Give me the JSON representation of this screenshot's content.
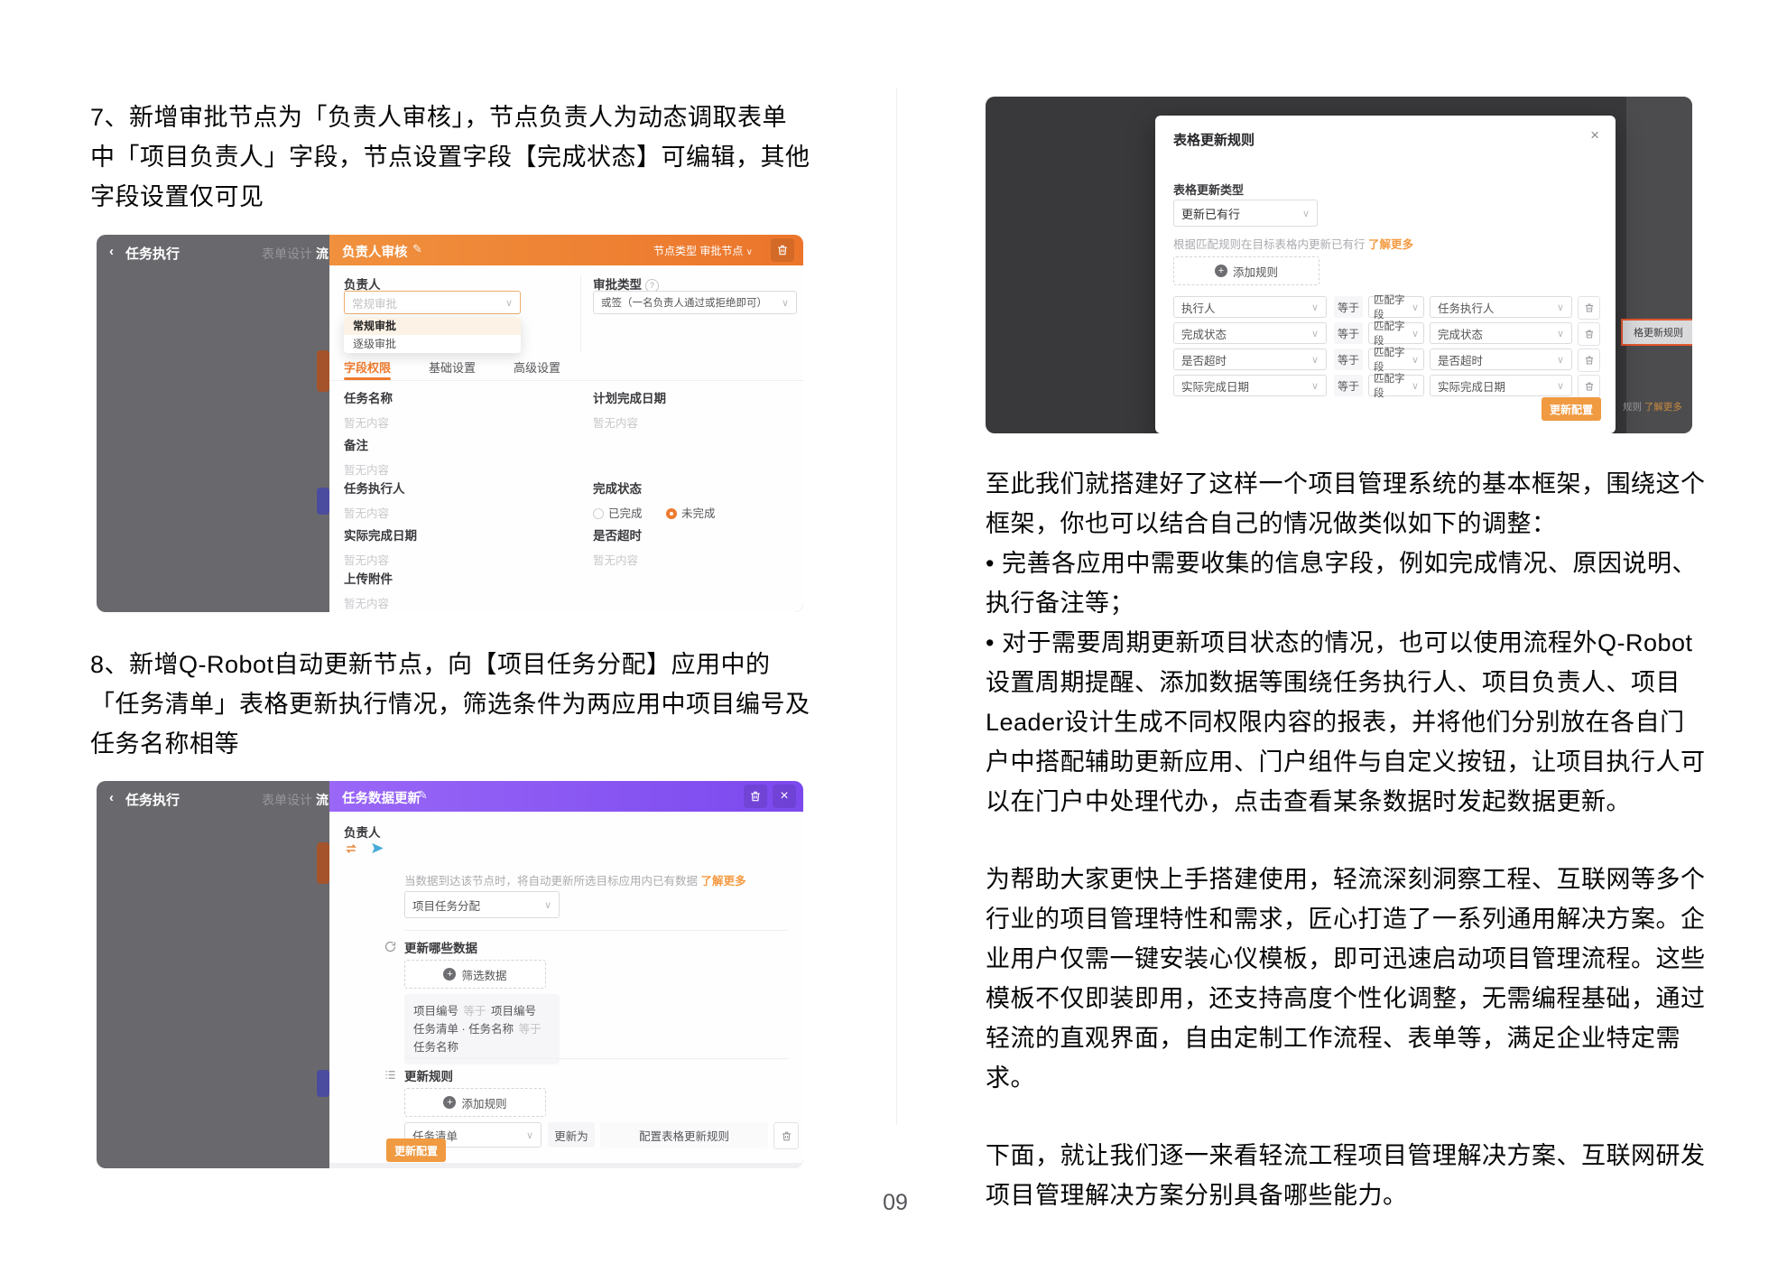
{
  "page": {
    "number": "09"
  },
  "icons": {
    "back": "‹",
    "chevron": "∨",
    "close": "×",
    "info": "?",
    "edit": "✎",
    "plus": "+"
  },
  "steps": {
    "step7": "7、新增审批节点为「负责人审核」，节点负责人为动态调取表单\n中「项目负责人」字段，节点设置字段【完成状态】可编辑，其他\n字段设置仅可见",
    "step8": "8、新增Q-Robot自动更新节点，向【项目任务分配】应用中的\n「任务清单」表格更新执行情况，筛选条件为两应用中项目编号及\n任务名称相等"
  },
  "paragraphs": {
    "p1": "至此我们就搭建好了这样一个项目管理系统的基本框架，围绕这个\n框架，你也可以结合自己的情况做类似如下的调整：\n• 完善各应用中需要收集的信息字段，例如完成情况、原因说明、\n执行备注等；\n• 对于需要周期更新项目状态的情况，也可以使用流程外Q-Robot\n设置周期提醒、添加数据等围绕任务执行人、项目负责人、项目\nLeader设计生成不同权限内容的报表，并将他们分别放在各自门\n户中搭配辅助更新应用、门户组件与自定义按钮，让项目执行人可\n以在门户中处理代办，点击查看某条数据时发起数据更新。",
    "p2": "为帮助大家更快上手搭建使用，轻流深刻洞察工程、互联网等多个\n行业的项目管理特性和需求，匠心打造了一系列通用解决方案。企\n业用户仅需一键安装心仪模板，即可迅速启动项目管理流程。这些\n模板不仅即装即用，还支持高度个性化调整，无需编程基础，通过\n轻流的直观界面，自由定制工作流程、表单等，满足企业特定需\n求。",
    "p3": "下面，就让我们逐一来看轻流工程项目管理解决方案、互联网研发\n项目管理解决方案分别具备哪些能力。"
  },
  "nav": {
    "app_title": "任务执行",
    "tab_form": "表单设计",
    "tab_partial": "流"
  },
  "approval": {
    "title": "负责人审核",
    "node_type_label": "节点类型",
    "node_type_value": "审批节点",
    "owner_label": "负责人",
    "owner_placeholder": "常规审批",
    "options": {
      "opt1": "常规审批",
      "opt2": "逐级审批"
    },
    "approval_type_label": "审批类型",
    "approval_type_value": "或签（一名负责人通过或拒绝即可）",
    "tabs": {
      "t1": "字段权限",
      "t2": "基础设置",
      "t3": "高级设置"
    },
    "empty": "暂无内容",
    "fields": {
      "task_name": "任务名称",
      "plan_date": "计划完成日期",
      "remark": "备注",
      "executor": "任务执行人",
      "status": "完成状态",
      "actual_date": "实际完成日期",
      "overtime": "是否超时",
      "attachment": "上传附件"
    },
    "status_options": {
      "done": "已完成",
      "undone": "未完成"
    }
  },
  "robot": {
    "title": "任务数据更新",
    "owner_label": "负责人",
    "helper": "当数据到达该节点时，将自动更新所选目标应用内已有数据",
    "learn_more": "了解更多",
    "app_value": "项目任务分配",
    "section_update": "更新哪些数据",
    "filter_btn": "筛选数据",
    "cond1": {
      "left": "项目编号",
      "op": "等于",
      "right": "项目编号"
    },
    "cond2": {
      "left": "任务清单 · 任务名称",
      "op": "等于",
      "right": "任务名称"
    },
    "section_rules": "更新规则",
    "add_rule_btn": "添加规则",
    "table_value": "任务清单",
    "update_to": "更新为",
    "configure": "配置表格更新规则",
    "submit": "更新配置"
  },
  "dialog": {
    "title": "表格更新规则",
    "type_label": "表格更新类型",
    "type_value": "更新已有行",
    "helper": "根据匹配规则在目标表格内更新已有行",
    "learn_more": "了解更多",
    "add_rule_btn": "添加规则",
    "rows": [
      {
        "field": "执行人",
        "op": "等于",
        "mode": "匹配字段",
        "value": "任务执行人"
      },
      {
        "field": "完成状态",
        "op": "等于",
        "mode": "匹配字段",
        "value": "完成状态"
      },
      {
        "field": "是否超时",
        "op": "等于",
        "mode": "匹配字段",
        "value": "是否超时"
      },
      {
        "field": "实际完成日期",
        "op": "等于",
        "mode": "匹配字段",
        "value": "实际完成日期"
      }
    ],
    "submit": "更新配置",
    "bg_box": "格更新规则",
    "bg_text1": "规则",
    "bg_text2": "了解更多"
  },
  "colors": {
    "accent_orange": "#ED7B2F",
    "accent_purple": "#8455F0",
    "link_orange": "#F59B43"
  }
}
